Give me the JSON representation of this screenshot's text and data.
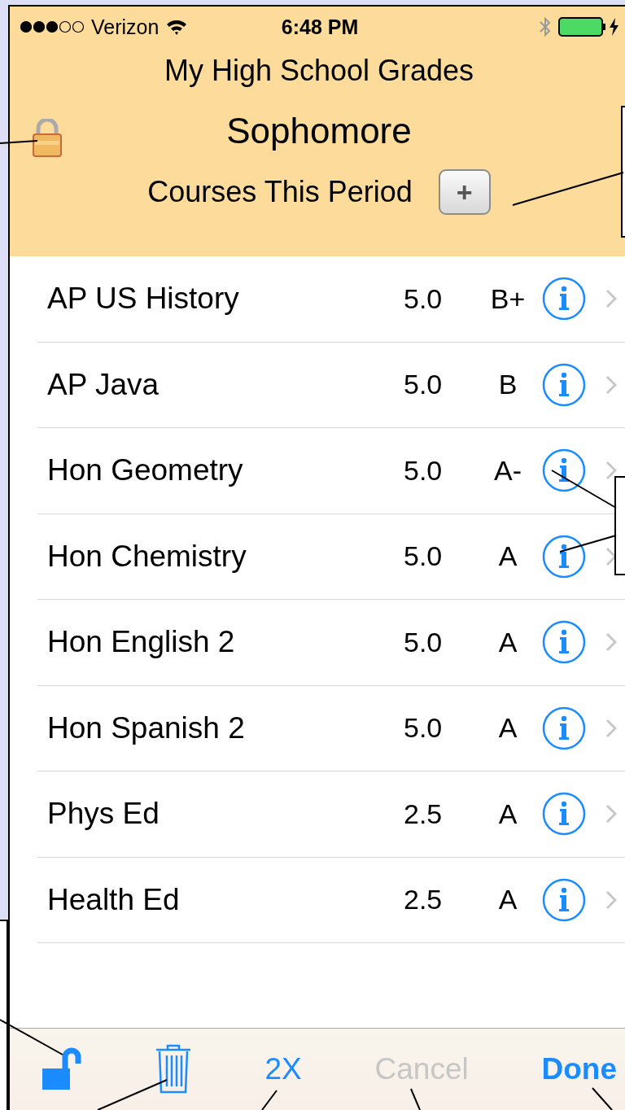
{
  "status_bar": {
    "carrier": "Verizon",
    "time": "6:48 PM"
  },
  "header": {
    "title": "My High School Grades",
    "period": "Sophomore",
    "section": "Courses This Period",
    "add_label": "+"
  },
  "courses": [
    {
      "name": "AP US History",
      "credits": "5.0",
      "grade": "B+"
    },
    {
      "name": "AP Java",
      "credits": "5.0",
      "grade": "B"
    },
    {
      "name": "Hon Geometry",
      "credits": "5.0",
      "grade": "A-"
    },
    {
      "name": "Hon Chemistry",
      "credits": "5.0",
      "grade": "A"
    },
    {
      "name": "Hon English 2",
      "credits": "5.0",
      "grade": "A"
    },
    {
      "name": "Hon Spanish 2",
      "credits": "5.0",
      "grade": "A"
    },
    {
      "name": "Phys Ed",
      "credits": "2.5",
      "grade": "A"
    },
    {
      "name": "Health Ed",
      "credits": "2.5",
      "grade": "A"
    }
  ],
  "toolbar": [
    {
      "kind": "unlock"
    },
    {
      "kind": "trash"
    },
    {
      "kind": "text",
      "label": "2X",
      "disabled": false
    },
    {
      "kind": "text",
      "label": "Cancel",
      "disabled": true
    },
    {
      "kind": "done",
      "label": "Done",
      "disabled": false
    }
  ]
}
